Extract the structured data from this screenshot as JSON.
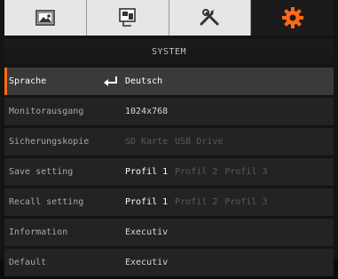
{
  "tabs": [
    {
      "name": "picture-icon",
      "active": false
    },
    {
      "name": "display-icon",
      "active": false
    },
    {
      "name": "tools-icon",
      "active": false
    },
    {
      "name": "gear-icon",
      "active": true
    }
  ],
  "accent_color": "#ff6a13",
  "title": "SYSTEM",
  "menu": [
    {
      "label": "Sprache",
      "values": [
        "Deutsch"
      ]
    },
    {
      "label": "Monitorausgang",
      "values": [
        "1024x768"
      ]
    },
    {
      "label": "Sicherungskopie",
      "values": [
        "SD Karte",
        "USB Drive"
      ]
    },
    {
      "label": "Save setting",
      "values": [
        "Profil 1",
        "Profil 2",
        "Profil 3"
      ]
    },
    {
      "label": "Recall setting",
      "values": [
        "Profil 1",
        "Profil 2",
        "Profil 3"
      ]
    },
    {
      "label": "Information",
      "values": [
        "Executiv"
      ]
    },
    {
      "label": "Default",
      "values": [
        "Executiv"
      ]
    }
  ]
}
